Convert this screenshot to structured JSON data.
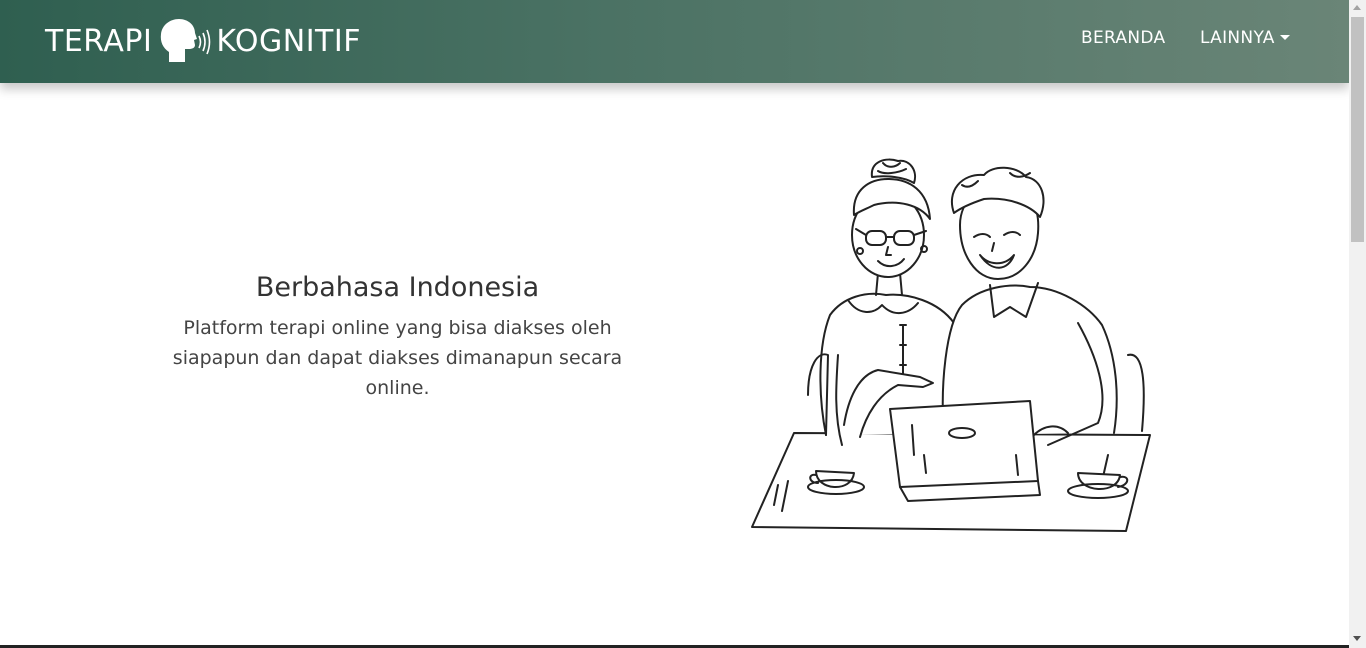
{
  "brand": {
    "left_word": "TERAPI",
    "right_word": "KOGNITIF",
    "logo_icon": "speaking-head-icon"
  },
  "nav": {
    "items": [
      {
        "label": "BERANDA"
      },
      {
        "label": "LAINNYA",
        "icon": "caret-down-icon"
      }
    ]
  },
  "hero": {
    "title": "Berbahasa Indonesia",
    "description": "Platform terapi online yang bisa diakses oleh siapapun dan dapat diakses dimanapun secara online.",
    "illustration_icon": "elderly-couple-laptop-illustration"
  },
  "colors": {
    "navbar_start": "#2f5f50",
    "navbar_end": "#6a8577",
    "text": "#333333"
  }
}
